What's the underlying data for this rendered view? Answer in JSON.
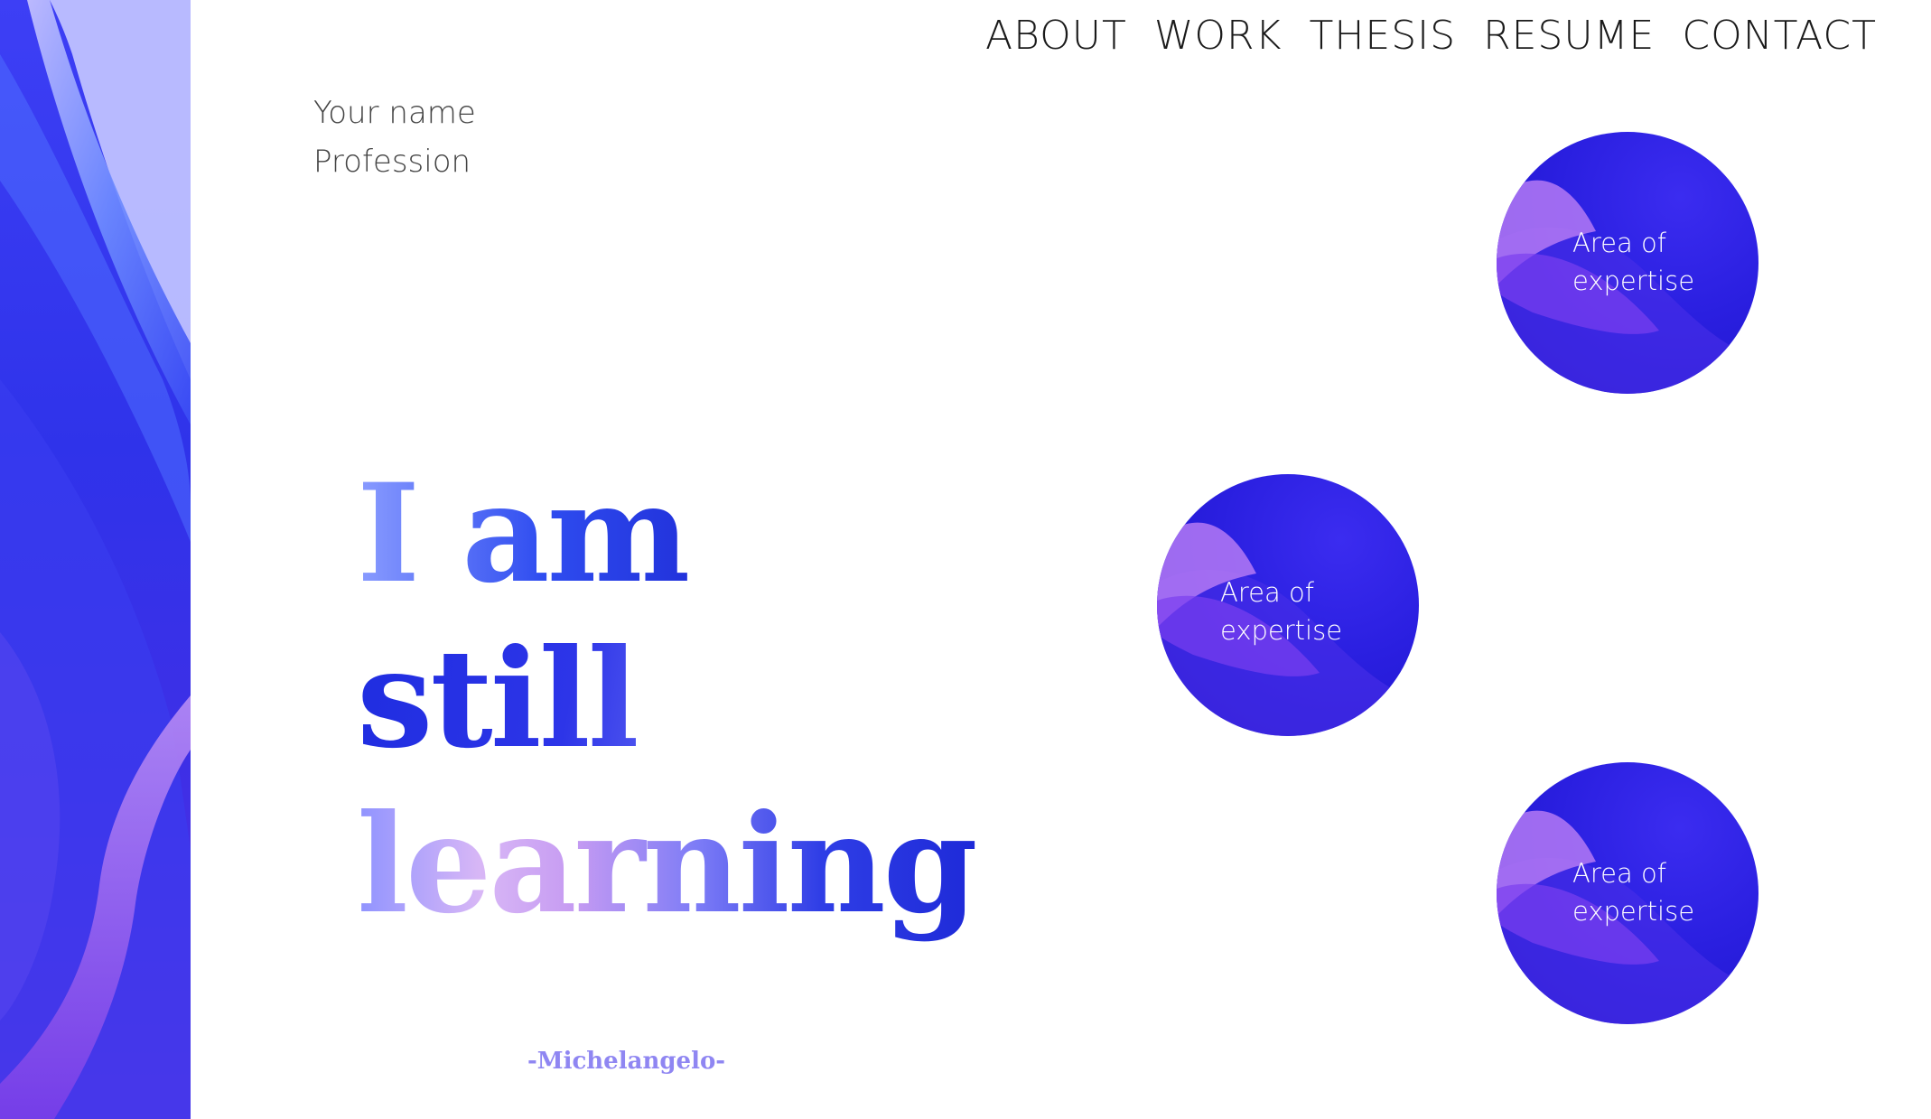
{
  "nav": {
    "items": [
      {
        "label": "ABOUT"
      },
      {
        "label": "WORK"
      },
      {
        "label": "THESIS"
      },
      {
        "label": "RESUME"
      },
      {
        "label": "CONTACT"
      }
    ]
  },
  "identity": {
    "name": "Your name",
    "profession": "Profession"
  },
  "headline": {
    "line1": "I am",
    "line2": "still",
    "line3": "learning",
    "author": "-Michelangelo-"
  },
  "expertise": [
    {
      "label_line1": "Area of",
      "label_line2": "expertise"
    },
    {
      "label_line1": "Area of",
      "label_line2": "expertise"
    },
    {
      "label_line1": "Area of",
      "label_line2": "expertise"
    }
  ],
  "colors": {
    "accent_blue": "#2f33ea",
    "accent_purple": "#8f86f2",
    "nav_text": "#1a1a1a"
  }
}
